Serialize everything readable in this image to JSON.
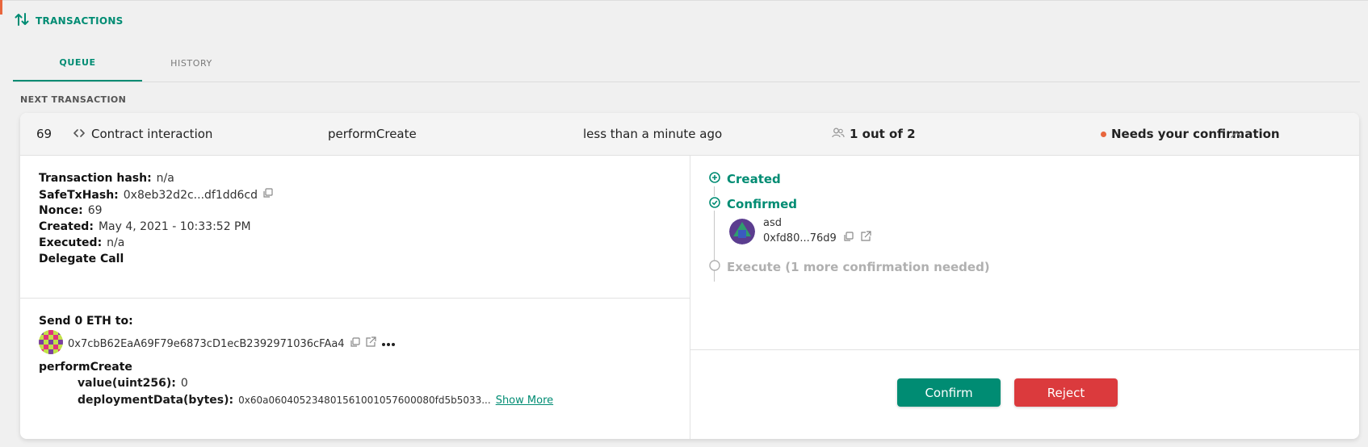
{
  "header": {
    "title": "TRANSACTIONS",
    "icon": "transactions-arrows-icon"
  },
  "tabs": [
    {
      "label": "QUEUE",
      "active": true
    },
    {
      "label": "HISTORY",
      "active": false
    }
  ],
  "section_label": "NEXT TRANSACTION",
  "transaction": {
    "nonce": "69",
    "type_icon": "code-icon",
    "type": "Contract interaction",
    "method": "performCreate",
    "time": "less than a minute ago",
    "confirmations": "1 out of 2",
    "status": "Needs your confirmation",
    "details": {
      "tx_hash_label": "Transaction hash:",
      "tx_hash_value": "n/a",
      "safe_tx_hash_label": "SafeTxHash:",
      "safe_tx_hash_value": "0x8eb32d2c...df1dd6cd",
      "nonce_label": "Nonce:",
      "nonce_value": "69",
      "created_label": "Created:",
      "created_value": "May 4, 2021 - 10:33:52 PM",
      "executed_label": "Executed:",
      "executed_value": "n/a",
      "delegate_call": "Delegate Call"
    },
    "data": {
      "send_label": "Send 0 ETH to:",
      "to_address": "0x7cbB62EaA69F79e6873cD1ecB2392971036cFAa4",
      "method_name": "performCreate",
      "params": [
        {
          "name": "value(uint256):",
          "value": "0"
        },
        {
          "name": "deploymentData(bytes):",
          "value": "0x60a060405234801561001057600080fd5b5033..."
        }
      ],
      "show_more": "Show More"
    },
    "timeline": {
      "created": "Created",
      "confirmed": "Confirmed",
      "owner_name": "asd",
      "owner_address": "0xfd80...76d9",
      "execute": "Execute (1 more confirmation needed)"
    },
    "actions": {
      "confirm": "Confirm",
      "reject": "Reject"
    }
  },
  "colors": {
    "primary": "#008c73",
    "warning": "#e8663d",
    "danger": "#db3a3d"
  }
}
